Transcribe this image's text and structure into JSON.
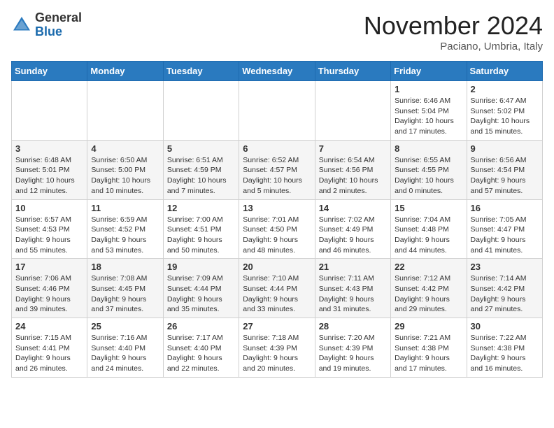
{
  "header": {
    "logo_general": "General",
    "logo_blue": "Blue",
    "month_title": "November 2024",
    "location": "Paciano, Umbria, Italy"
  },
  "days_of_week": [
    "Sunday",
    "Monday",
    "Tuesday",
    "Wednesday",
    "Thursday",
    "Friday",
    "Saturday"
  ],
  "weeks": [
    [
      {
        "day": "",
        "info": ""
      },
      {
        "day": "",
        "info": ""
      },
      {
        "day": "",
        "info": ""
      },
      {
        "day": "",
        "info": ""
      },
      {
        "day": "",
        "info": ""
      },
      {
        "day": "1",
        "info": "Sunrise: 6:46 AM\nSunset: 5:04 PM\nDaylight: 10 hours and 17 minutes."
      },
      {
        "day": "2",
        "info": "Sunrise: 6:47 AM\nSunset: 5:02 PM\nDaylight: 10 hours and 15 minutes."
      }
    ],
    [
      {
        "day": "3",
        "info": "Sunrise: 6:48 AM\nSunset: 5:01 PM\nDaylight: 10 hours and 12 minutes."
      },
      {
        "day": "4",
        "info": "Sunrise: 6:50 AM\nSunset: 5:00 PM\nDaylight: 10 hours and 10 minutes."
      },
      {
        "day": "5",
        "info": "Sunrise: 6:51 AM\nSunset: 4:59 PM\nDaylight: 10 hours and 7 minutes."
      },
      {
        "day": "6",
        "info": "Sunrise: 6:52 AM\nSunset: 4:57 PM\nDaylight: 10 hours and 5 minutes."
      },
      {
        "day": "7",
        "info": "Sunrise: 6:54 AM\nSunset: 4:56 PM\nDaylight: 10 hours and 2 minutes."
      },
      {
        "day": "8",
        "info": "Sunrise: 6:55 AM\nSunset: 4:55 PM\nDaylight: 10 hours and 0 minutes."
      },
      {
        "day": "9",
        "info": "Sunrise: 6:56 AM\nSunset: 4:54 PM\nDaylight: 9 hours and 57 minutes."
      }
    ],
    [
      {
        "day": "10",
        "info": "Sunrise: 6:57 AM\nSunset: 4:53 PM\nDaylight: 9 hours and 55 minutes."
      },
      {
        "day": "11",
        "info": "Sunrise: 6:59 AM\nSunset: 4:52 PM\nDaylight: 9 hours and 53 minutes."
      },
      {
        "day": "12",
        "info": "Sunrise: 7:00 AM\nSunset: 4:51 PM\nDaylight: 9 hours and 50 minutes."
      },
      {
        "day": "13",
        "info": "Sunrise: 7:01 AM\nSunset: 4:50 PM\nDaylight: 9 hours and 48 minutes."
      },
      {
        "day": "14",
        "info": "Sunrise: 7:02 AM\nSunset: 4:49 PM\nDaylight: 9 hours and 46 minutes."
      },
      {
        "day": "15",
        "info": "Sunrise: 7:04 AM\nSunset: 4:48 PM\nDaylight: 9 hours and 44 minutes."
      },
      {
        "day": "16",
        "info": "Sunrise: 7:05 AM\nSunset: 4:47 PM\nDaylight: 9 hours and 41 minutes."
      }
    ],
    [
      {
        "day": "17",
        "info": "Sunrise: 7:06 AM\nSunset: 4:46 PM\nDaylight: 9 hours and 39 minutes."
      },
      {
        "day": "18",
        "info": "Sunrise: 7:08 AM\nSunset: 4:45 PM\nDaylight: 9 hours and 37 minutes."
      },
      {
        "day": "19",
        "info": "Sunrise: 7:09 AM\nSunset: 4:44 PM\nDaylight: 9 hours and 35 minutes."
      },
      {
        "day": "20",
        "info": "Sunrise: 7:10 AM\nSunset: 4:44 PM\nDaylight: 9 hours and 33 minutes."
      },
      {
        "day": "21",
        "info": "Sunrise: 7:11 AM\nSunset: 4:43 PM\nDaylight: 9 hours and 31 minutes."
      },
      {
        "day": "22",
        "info": "Sunrise: 7:12 AM\nSunset: 4:42 PM\nDaylight: 9 hours and 29 minutes."
      },
      {
        "day": "23",
        "info": "Sunrise: 7:14 AM\nSunset: 4:42 PM\nDaylight: 9 hours and 27 minutes."
      }
    ],
    [
      {
        "day": "24",
        "info": "Sunrise: 7:15 AM\nSunset: 4:41 PM\nDaylight: 9 hours and 26 minutes."
      },
      {
        "day": "25",
        "info": "Sunrise: 7:16 AM\nSunset: 4:40 PM\nDaylight: 9 hours and 24 minutes."
      },
      {
        "day": "26",
        "info": "Sunrise: 7:17 AM\nSunset: 4:40 PM\nDaylight: 9 hours and 22 minutes."
      },
      {
        "day": "27",
        "info": "Sunrise: 7:18 AM\nSunset: 4:39 PM\nDaylight: 9 hours and 20 minutes."
      },
      {
        "day": "28",
        "info": "Sunrise: 7:20 AM\nSunset: 4:39 PM\nDaylight: 9 hours and 19 minutes."
      },
      {
        "day": "29",
        "info": "Sunrise: 7:21 AM\nSunset: 4:38 PM\nDaylight: 9 hours and 17 minutes."
      },
      {
        "day": "30",
        "info": "Sunrise: 7:22 AM\nSunset: 4:38 PM\nDaylight: 9 hours and 16 minutes."
      }
    ]
  ]
}
